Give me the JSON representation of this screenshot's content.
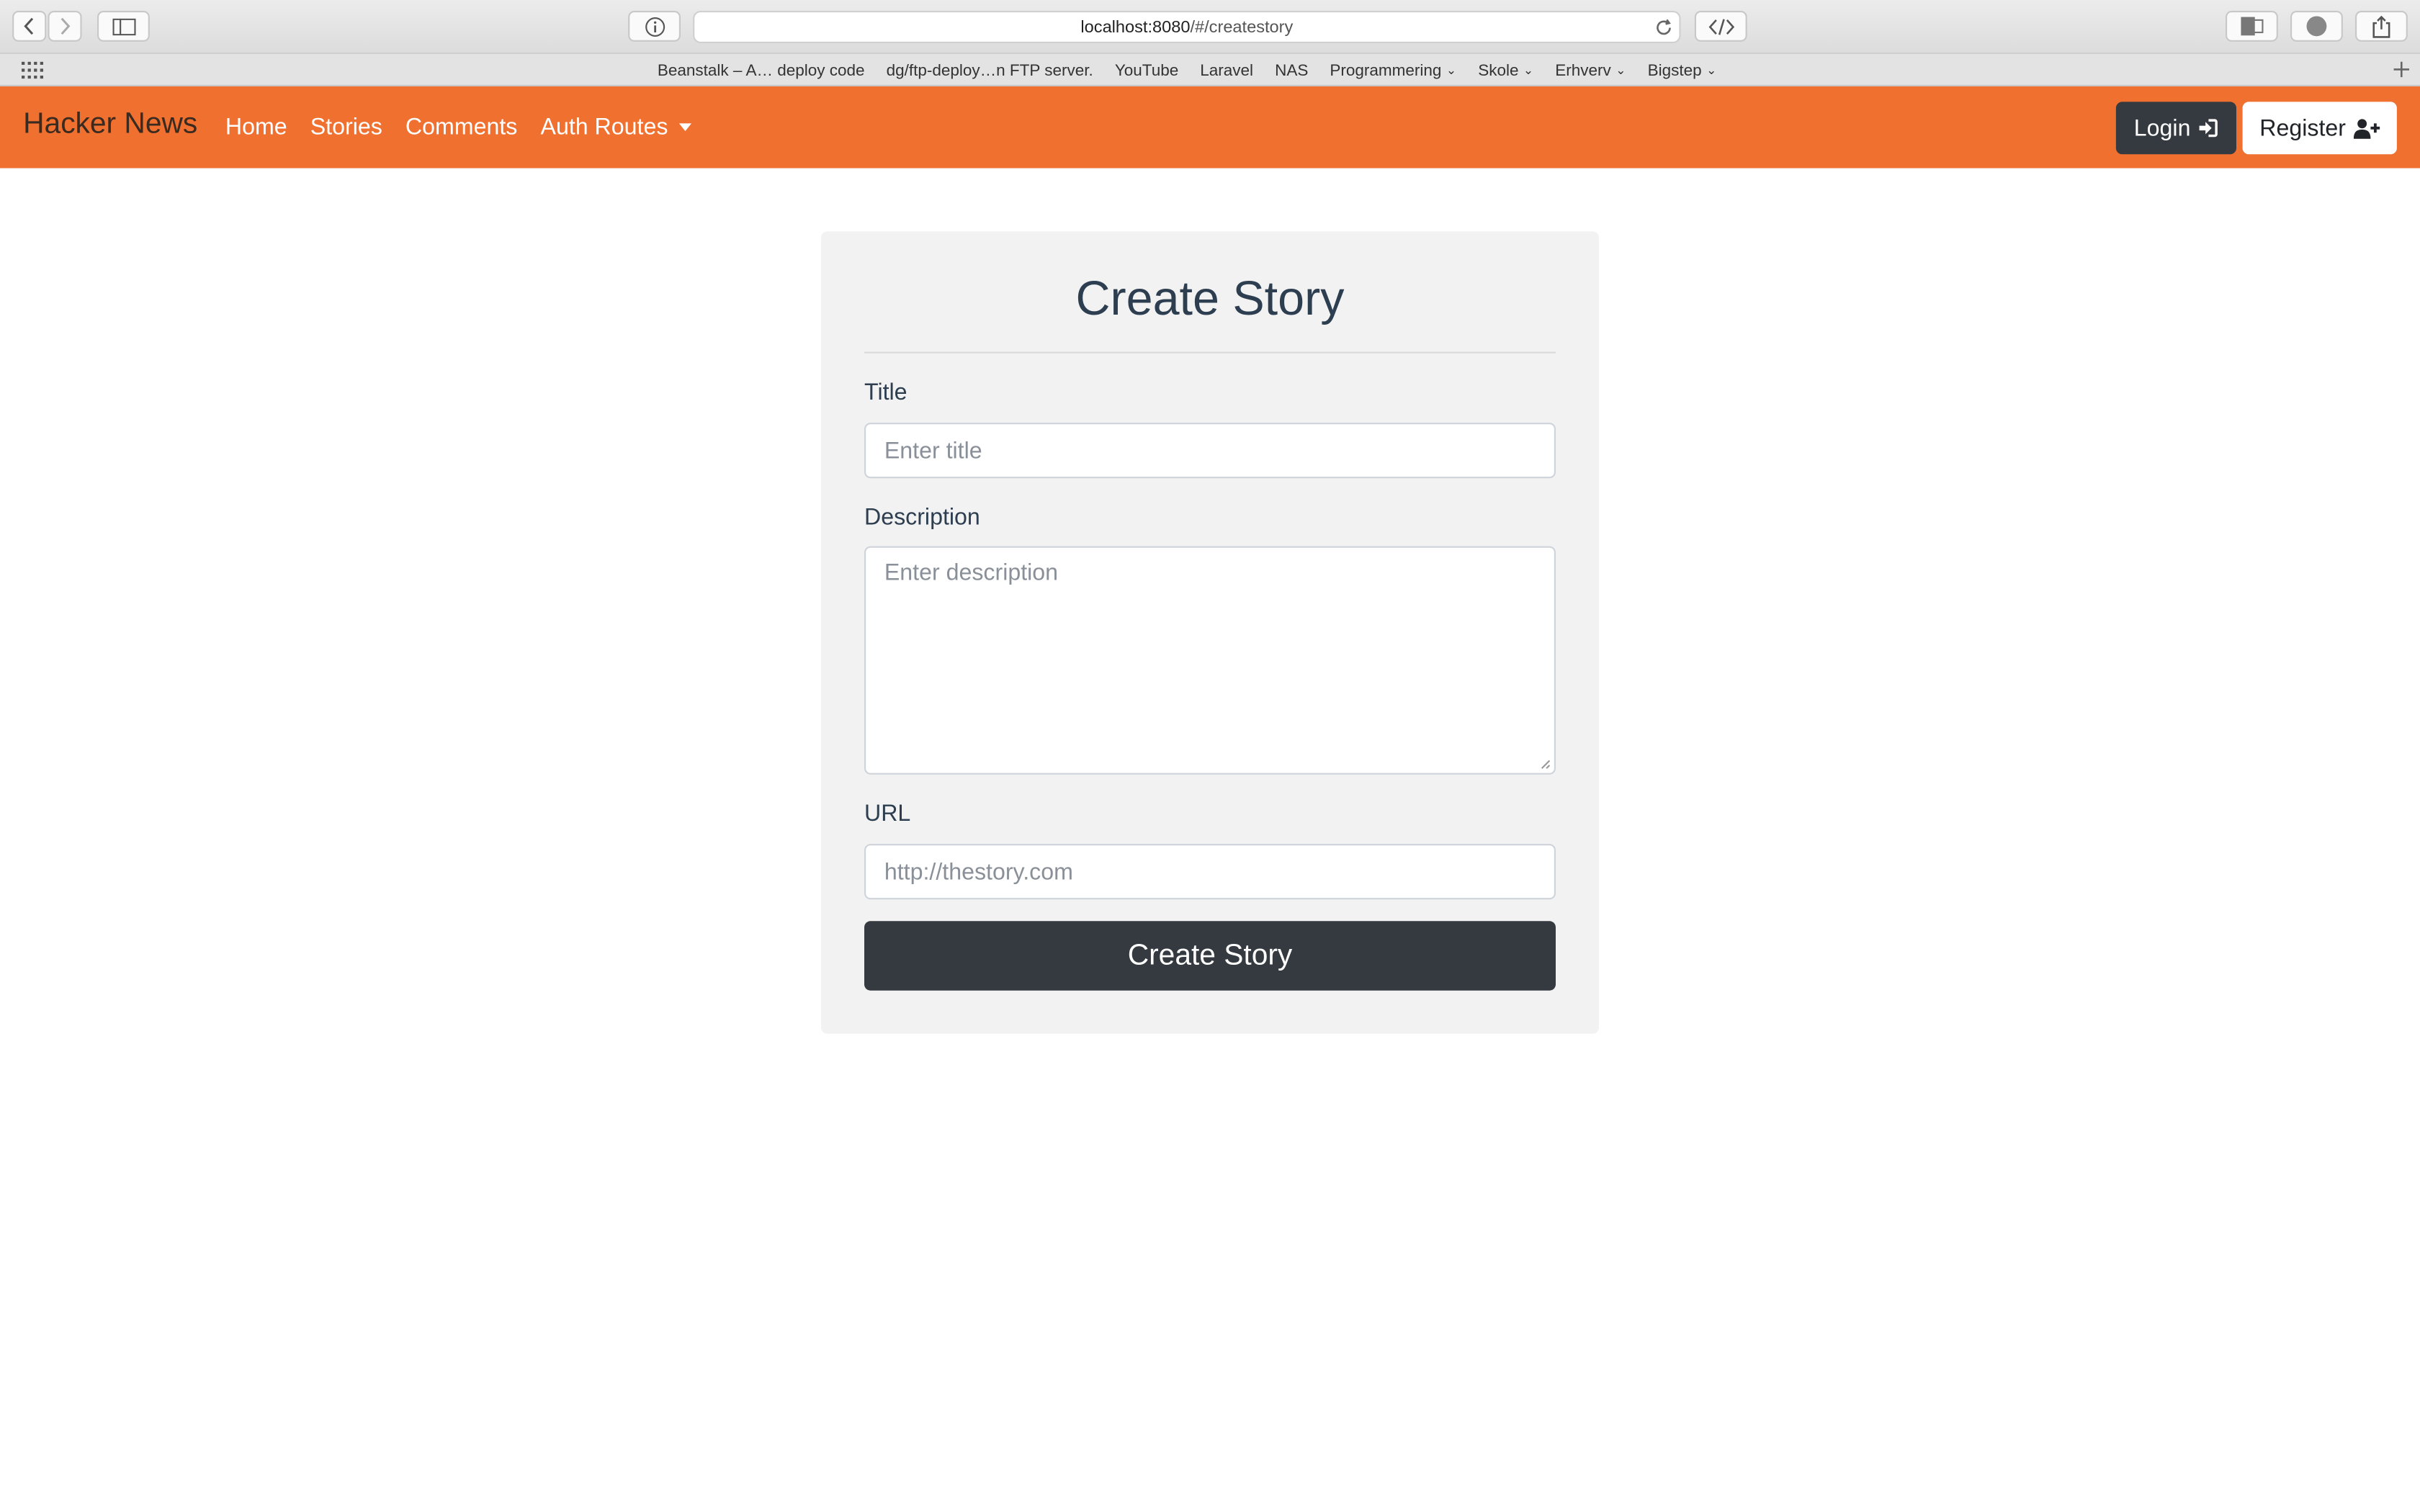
{
  "browser": {
    "url_host": "localhost:8080",
    "url_path": "/#/createstory",
    "bookmarks": [
      {
        "label": "Beanstalk – A… deploy code",
        "dropdown": false
      },
      {
        "label": "dg/ftp-deploy…n FTP server.",
        "dropdown": false
      },
      {
        "label": "YouTube",
        "dropdown": false
      },
      {
        "label": "Laravel",
        "dropdown": false
      },
      {
        "label": "NAS",
        "dropdown": false
      },
      {
        "label": "Programmering",
        "dropdown": true
      },
      {
        "label": "Skole",
        "dropdown": true
      },
      {
        "label": "Erhverv",
        "dropdown": true
      },
      {
        "label": "Bigstep",
        "dropdown": true
      }
    ]
  },
  "navbar": {
    "brand": "Hacker News",
    "links": [
      "Home",
      "Stories",
      "Comments"
    ],
    "dropdown": "Auth Routes",
    "login": "Login",
    "register": "Register",
    "color": "#f07030"
  },
  "form": {
    "heading": "Create Story",
    "title_label": "Title",
    "title_placeholder": "Enter title",
    "description_label": "Description",
    "description_placeholder": "Enter description",
    "url_label": "URL",
    "url_placeholder": "http://thestory.com",
    "submit": "Create Story"
  }
}
